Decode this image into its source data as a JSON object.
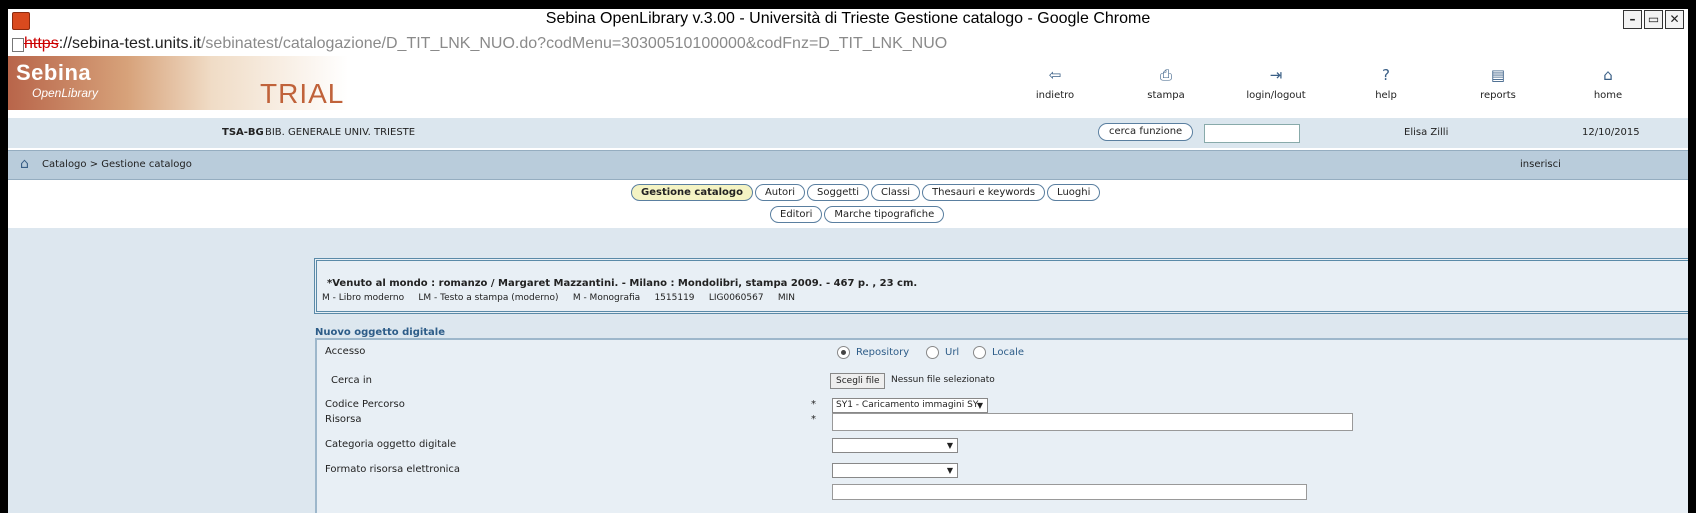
{
  "window": {
    "title": "Sebina OpenLibrary v.3.00 - Università di Trieste Gestione catalogo - Google Chrome",
    "buttons": [
      "–",
      "▭",
      "✕"
    ]
  },
  "url": {
    "scheme": "https",
    "host": "://sebina-test.units.it",
    "path": "/sebinatest/catalogazione/D_TIT_LNK_NUO.do?codMenu=30300510100000&codFnz=D_TIT_LNK_NUO"
  },
  "logo": {
    "brand": "Sebina",
    "sub": "OpenLibrary",
    "trial": "TRIAL"
  },
  "toolbar": [
    {
      "icon": "⇦",
      "label": "indietro"
    },
    {
      "icon": "⎙",
      "label": "stampa"
    },
    {
      "icon": "⇥",
      "label": "login/logout"
    },
    {
      "icon": "?",
      "label": "help"
    },
    {
      "icon": "▤",
      "label": "reports"
    },
    {
      "icon": "⌂",
      "label": "home"
    }
  ],
  "infobar": {
    "lib_code": "TSA-BG",
    "lib_name": "BIB. GENERALE UNIV. TRIESTE",
    "cerca_label": "cerca funzione",
    "cerca_value": "",
    "user": "Elisa Zilli",
    "date": "12/10/2015"
  },
  "breadcrumb": {
    "home_icon": "⌂",
    "path": "Catalogo > Gestione catalogo",
    "action": "inserisci"
  },
  "tabs_row1": [
    "Gestione catalogo",
    "Autori",
    "Soggetti",
    "Classi",
    "Thesauri e keywords",
    "Luoghi"
  ],
  "tabs_row2": [
    "Editori",
    "Marche tipografiche"
  ],
  "record": {
    "title": "*Venuto al mondo : romanzo / Margaret Mazzantini. - Milano : Mondolibri, stampa 2009. - 467 p. , 23 cm.",
    "meta": "M - Libro moderno     LM - Testo a stampa (moderno)     M - Monografia     1515119     LIG0060567     MIN"
  },
  "form": {
    "section_title": "Nuovo oggetto digitale",
    "accesso_label": "Accesso",
    "accesso_options": [
      "Repository",
      "Url",
      "Locale"
    ],
    "cerca_in_label": "Cerca in",
    "file_button": "Scegli file",
    "file_status": "Nessun file selezionato",
    "codice_label": "Codice Percorso",
    "codice_value": "SY1 - Caricamento immagini SY",
    "risorsa_label": "Risorsa",
    "risorsa_value": "",
    "categoria_label": "Categoria oggetto digitale",
    "categoria_value": "",
    "formato_label": "Formato risorsa elettronica",
    "formato_value": "",
    "required_mark": "*"
  }
}
